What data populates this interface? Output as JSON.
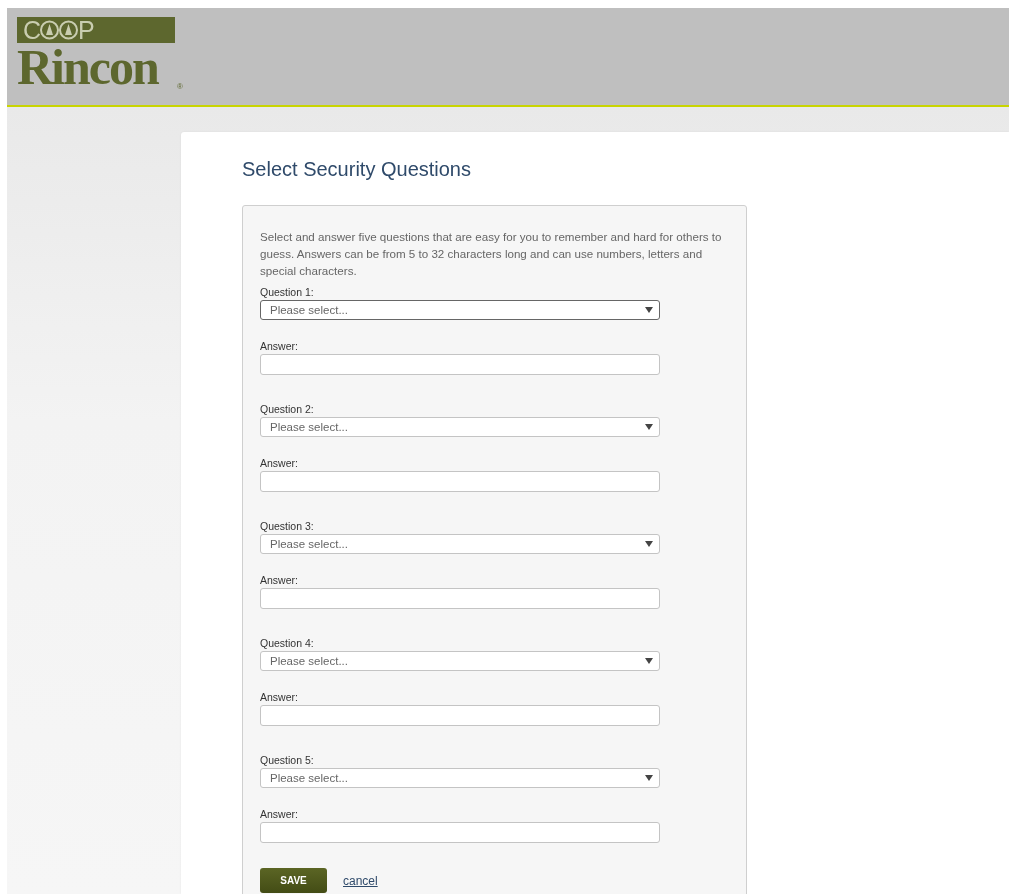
{
  "logo": {
    "top_start": "C",
    "top_end": "P",
    "bottom": "Rincon",
    "registered": "®"
  },
  "title": "Select Security Questions",
  "intro": "Select and answer five questions that are easy for you to remember and hard for others to guess. Answers can be from 5 to 32 characters long and can use numbers, letters and special characters.",
  "questions": [
    {
      "label": "Question 1:",
      "placeholder": "Please select...",
      "focused": true,
      "answer_label": "Answer:"
    },
    {
      "label": "Question 2:",
      "placeholder": "Please select...",
      "focused": false,
      "answer_label": "Answer:"
    },
    {
      "label": "Question 3:",
      "placeholder": "Please select...",
      "focused": false,
      "answer_label": "Answer:"
    },
    {
      "label": "Question 4:",
      "placeholder": "Please select...",
      "focused": false,
      "answer_label": "Answer:"
    },
    {
      "label": "Question 5:",
      "placeholder": "Please select...",
      "focused": false,
      "answer_label": "Answer:"
    }
  ],
  "save": "SAVE",
  "cancel": "cancel"
}
